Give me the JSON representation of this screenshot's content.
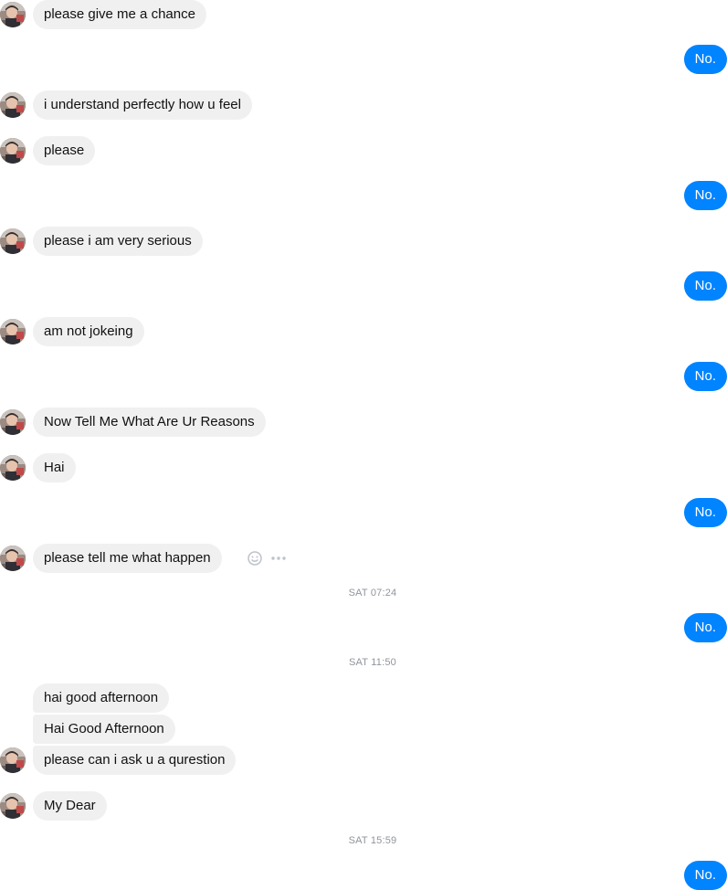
{
  "colors": {
    "incoming_bubble": "#f1f0f0",
    "outgoing_bubble": "#0084ff",
    "timestamp": "#90949c"
  },
  "messages": [
    {
      "text": "please give me a chance"
    },
    {
      "text": "No."
    },
    {
      "text": "i understand perfectly how u feel"
    },
    {
      "text": "please"
    },
    {
      "text": "No."
    },
    {
      "text": "please i am very serious"
    },
    {
      "text": "No."
    },
    {
      "text": "am not jokeing"
    },
    {
      "text": "No."
    },
    {
      "text": "Now Tell Me What Are Ur Reasons"
    },
    {
      "text": "Hai"
    },
    {
      "text": "No."
    },
    {
      "text": "please tell me what happen"
    },
    {
      "text": "SAT 07:24"
    },
    {
      "text": "No."
    },
    {
      "text": "SAT 11:50"
    },
    {
      "text": "hai good afternoon"
    },
    {
      "text": "Hai Good Afternoon"
    },
    {
      "text": "please can i ask u a qurestion"
    },
    {
      "text": "My Dear"
    },
    {
      "text": "SAT 15:59"
    },
    {
      "text": "No."
    }
  ],
  "hover_actions": [
    "emoji-icon",
    "more-icon"
  ]
}
